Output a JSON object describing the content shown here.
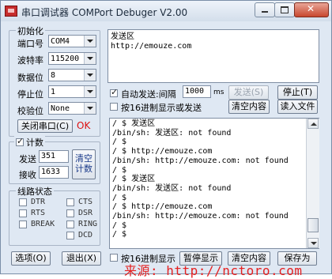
{
  "window": {
    "title": "串口调试器 COMPort Debuger V2.00"
  },
  "init": {
    "group_title": "初始化",
    "port": {
      "label": "端口号",
      "value": "COM4"
    },
    "baud": {
      "label": "波特率",
      "value": "115200"
    },
    "data_bits": {
      "label": "数据位",
      "value": "8"
    },
    "stop_bits": {
      "label": "停止位",
      "value": "1"
    },
    "parity": {
      "label": "校验位",
      "value": "None"
    },
    "close_button": "关闭串口(C)",
    "status": "OK"
  },
  "count": {
    "group_title": "计数",
    "enabled": true,
    "send_label": "发送",
    "send_value": "351",
    "recv_label": "接收",
    "recv_value": "1633",
    "clear_button": "清空计数"
  },
  "line_status": {
    "group_title": "线路状态",
    "items": [
      "DTR",
      "CTS",
      "RTS",
      "DSR",
      "BREAK",
      "RING",
      "DCD"
    ]
  },
  "send_area": {
    "text_line1": "发送区",
    "text_line2": "http://emouze.com",
    "auto_send_label": "自动发送:间隔",
    "interval_value": "1000",
    "interval_unit": "ms",
    "send_button": "发送(S)",
    "stop_button": "停止(T)",
    "hex_send_label": "按16进制显示或发送",
    "clear_button": "清空内容",
    "read_file_button": "读入文件"
  },
  "log": {
    "lines": [
      "/ $ 发送区",
      "/bin/sh: 发送区: not found",
      "/ $",
      "/ $ http://emouze.com",
      "/bin/sh: http://emouze.com: not found",
      "/ $",
      "/ $ 发送区",
      "/bin/sh: 发送区: not found",
      "/ $",
      "/ $ http://emouze.com",
      "/bin/sh: http://emouze.com: not found",
      "/ $",
      "/ $"
    ]
  },
  "bottom": {
    "options_button": "选项(O)",
    "exit_button": "退出(X)",
    "hex_display_label": "按16进制显示",
    "pause_button": "暂停显示",
    "clear_button": "清空内容",
    "save_button": "保存为"
  },
  "watermark": "来源: http://nctoro.com"
}
